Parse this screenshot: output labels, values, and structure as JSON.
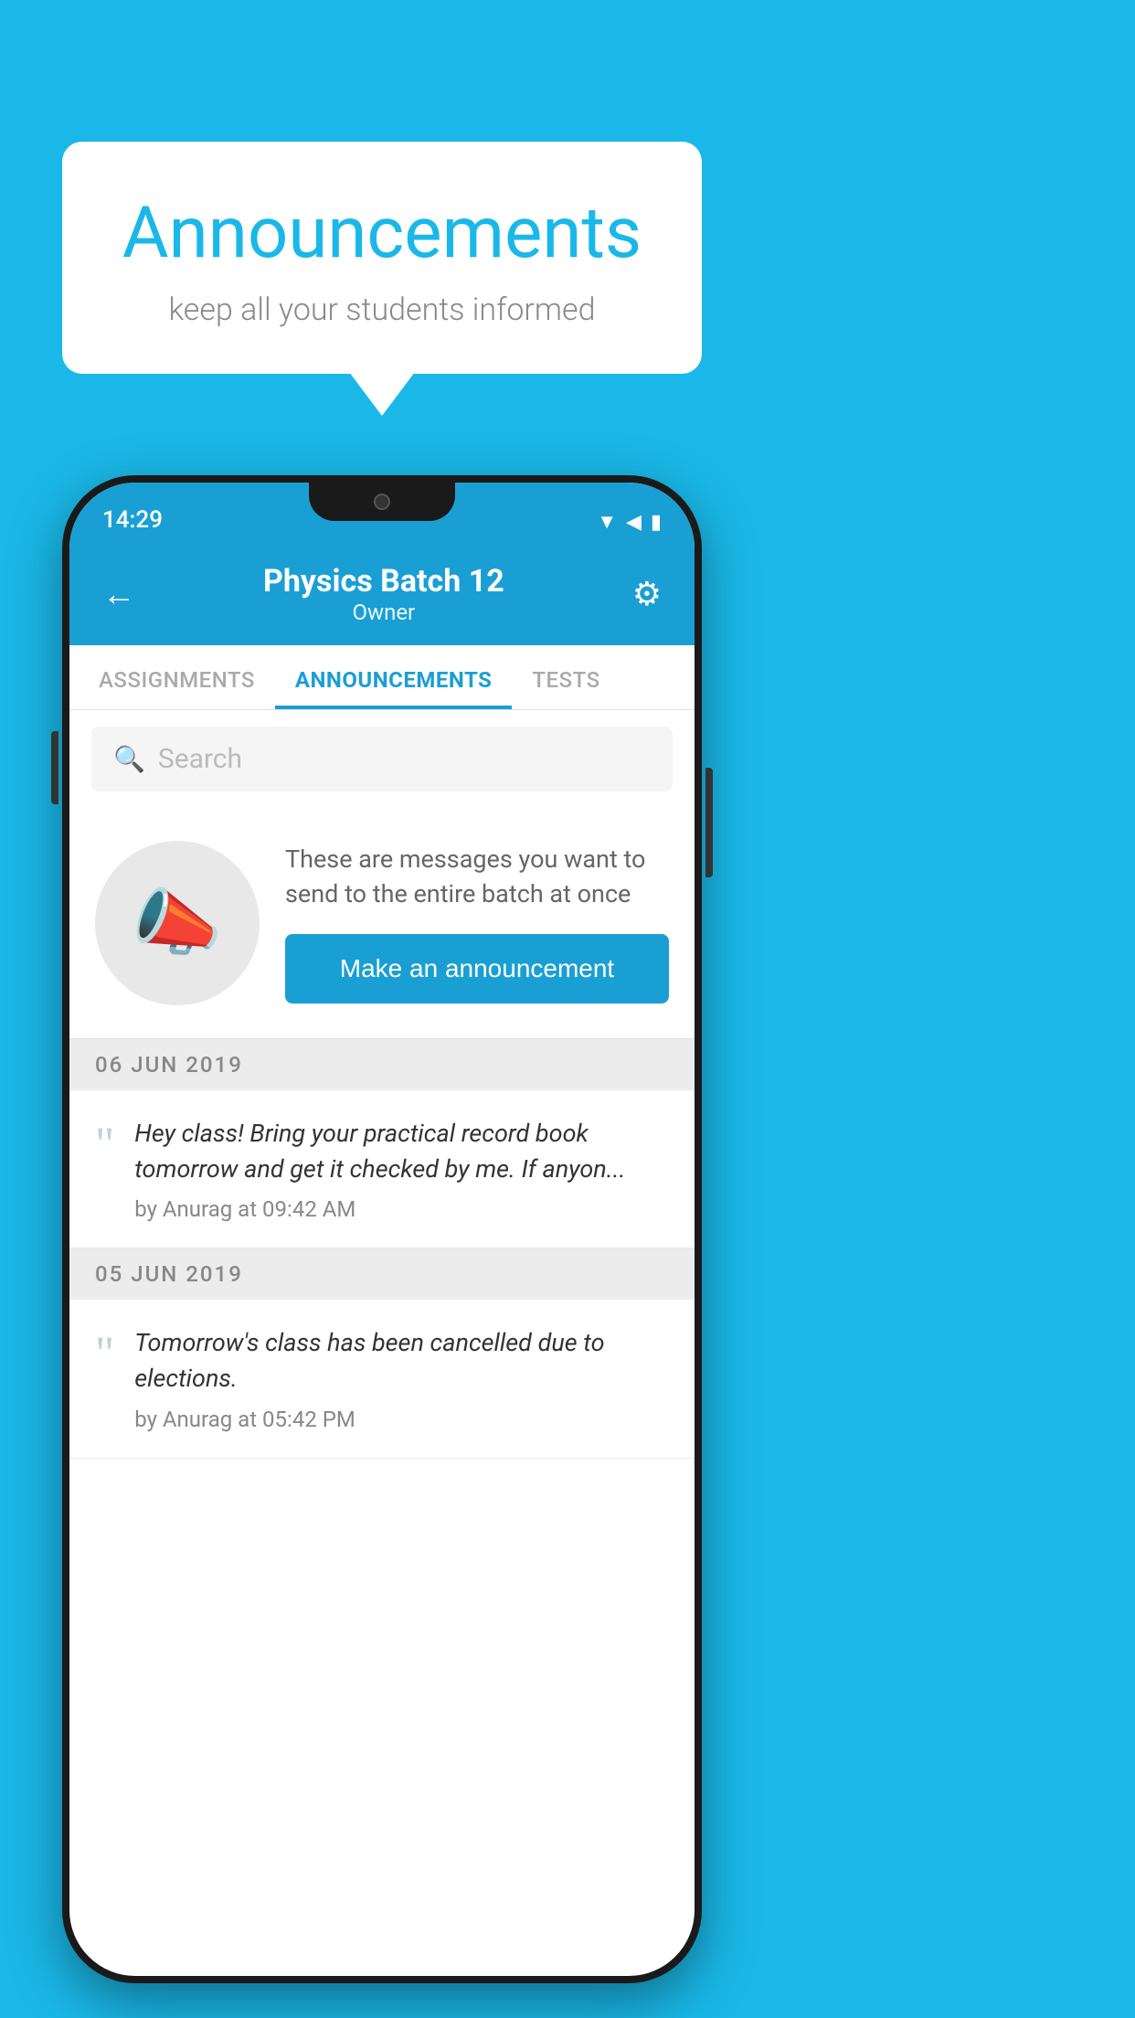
{
  "background_color": "#1ab8e8",
  "speech_bubble": {
    "title": "Announcements",
    "subtitle": "keep all your students informed"
  },
  "phone": {
    "status_bar": {
      "time": "14:29",
      "icons": [
        "wifi",
        "signal",
        "battery"
      ]
    },
    "header": {
      "title": "Physics Batch 12",
      "subtitle": "Owner",
      "back_label": "←",
      "gear_label": "⚙"
    },
    "tabs": [
      {
        "label": "ASSIGNMENTS",
        "active": false
      },
      {
        "label": "ANNOUNCEMENTS",
        "active": true
      },
      {
        "label": "TESTS",
        "active": false
      }
    ],
    "search": {
      "placeholder": "Search"
    },
    "promo": {
      "description": "These are messages you want to send to the entire batch at once",
      "button_label": "Make an announcement"
    },
    "announcements": [
      {
        "date": "06  JUN  2019",
        "text": "Hey class! Bring your practical record book tomorrow and get it checked by me. If anyon...",
        "meta": "by Anurag at 09:42 AM"
      },
      {
        "date": "05  JUN  2019",
        "text": "Tomorrow's class has been cancelled due to elections.",
        "meta": "by Anurag at 05:42 PM"
      }
    ]
  }
}
